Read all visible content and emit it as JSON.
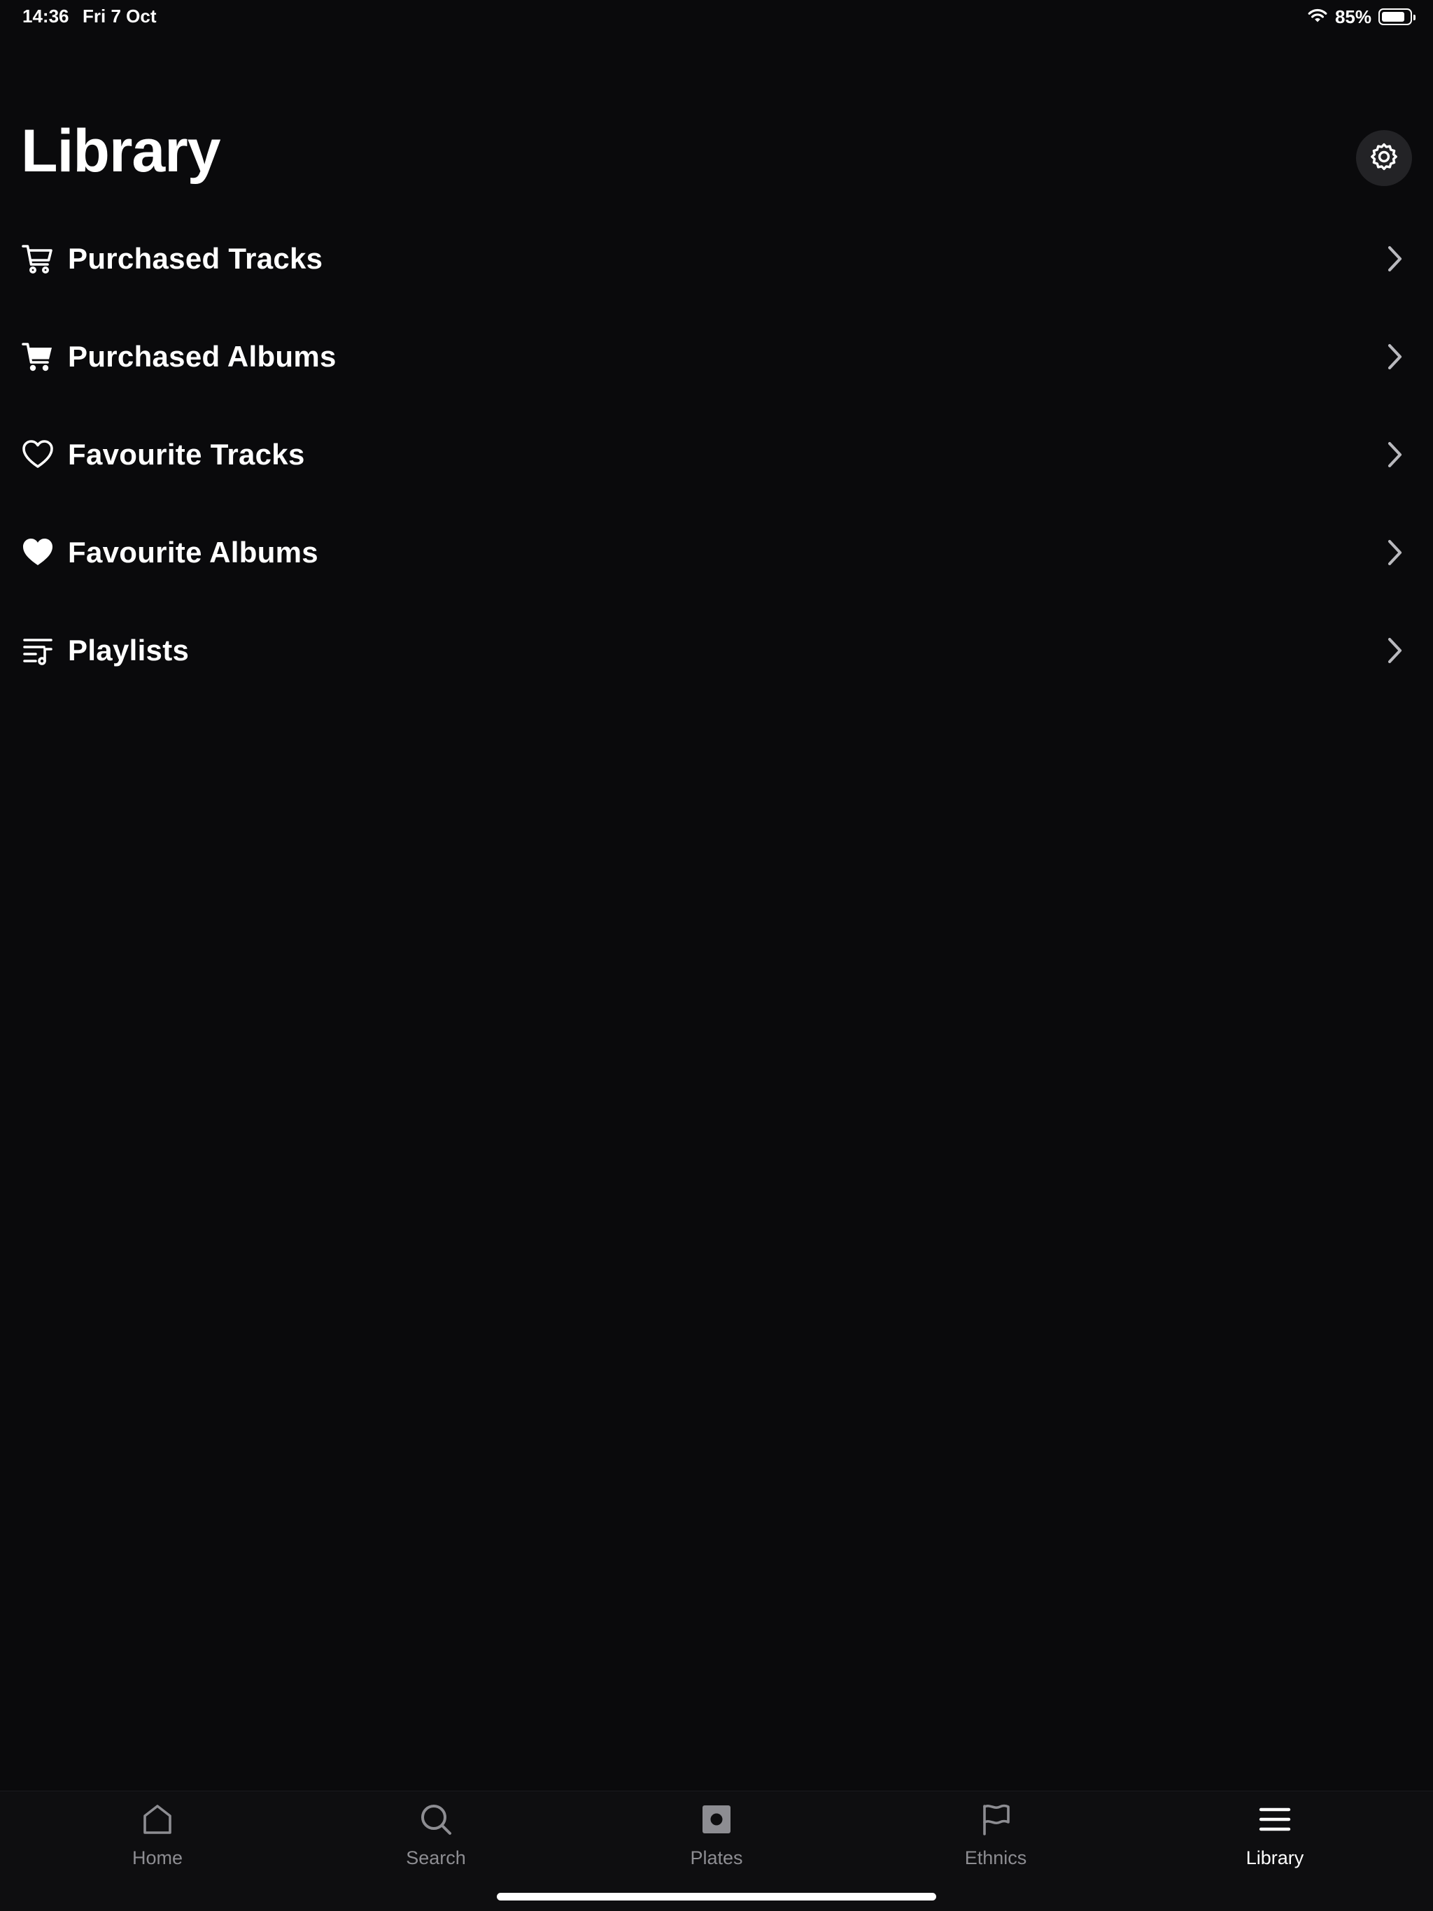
{
  "status_bar": {
    "time": "14:36",
    "date": "Fri 7 Oct",
    "battery_percent_label": "85%",
    "battery_level": 0.85,
    "wifi_icon": "wifi-icon",
    "battery_icon": "battery-icon"
  },
  "header": {
    "title": "Library",
    "settings_icon": "gear-icon"
  },
  "menu": {
    "items": [
      {
        "label": "Purchased Tracks",
        "icon": "cart-outline-icon"
      },
      {
        "label": "Purchased Albums",
        "icon": "cart-filled-icon"
      },
      {
        "label": "Favourite Tracks",
        "icon": "heart-outline-icon"
      },
      {
        "label": "Favourite Albums",
        "icon": "heart-filled-icon"
      },
      {
        "label": "Playlists",
        "icon": "playlist-icon"
      }
    ],
    "chevron_icon": "chevron-right-icon"
  },
  "tab_bar": {
    "tabs": [
      {
        "label": "Home",
        "icon": "home-icon",
        "active": false
      },
      {
        "label": "Search",
        "icon": "search-icon",
        "active": false
      },
      {
        "label": "Plates",
        "icon": "record-icon",
        "active": false
      },
      {
        "label": "Ethnics",
        "icon": "flag-icon",
        "active": false
      },
      {
        "label": "Library",
        "icon": "menu-icon",
        "active": true
      }
    ]
  },
  "colors": {
    "background": "#0a0a0c",
    "text": "#ffffff",
    "inactive_tab": "#8d8d92",
    "settings_button_bg": "#232326"
  }
}
